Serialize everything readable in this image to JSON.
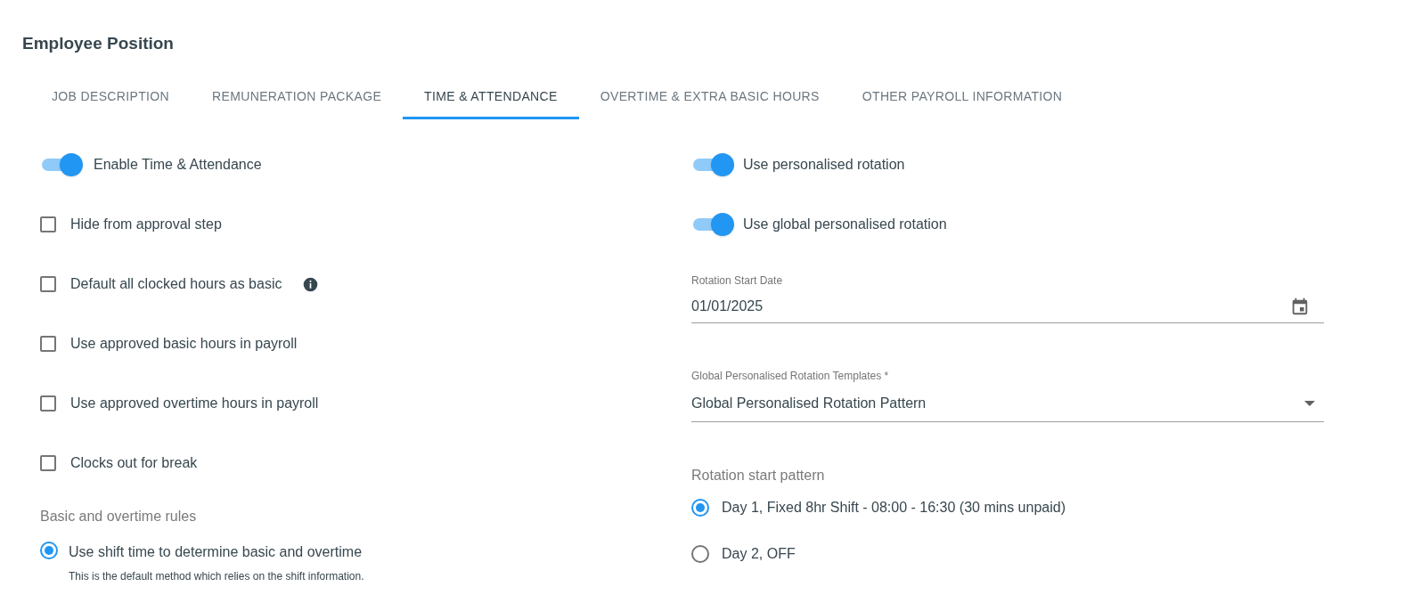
{
  "title": "Employee Position",
  "tabs": [
    {
      "label": "JOB DESCRIPTION",
      "selected": false
    },
    {
      "label": "REMUNERATION PACKAGE",
      "selected": false
    },
    {
      "label": "TIME & ATTENDANCE",
      "selected": true
    },
    {
      "label": "OVERTIME & EXTRA BASIC HOURS",
      "selected": false
    },
    {
      "label": "OTHER PAYROLL INFORMATION",
      "selected": false
    }
  ],
  "left_options": [
    {
      "kind": "toggle",
      "label": "Enable Time & Attendance",
      "on": true
    },
    {
      "kind": "checkbox",
      "label": "Hide from approval step",
      "checked": false
    },
    {
      "kind": "info_checkbox",
      "label": "Default all clocked hours as basic",
      "checked": false
    },
    {
      "kind": "checkbox",
      "label": "Use approved basic hours in payroll",
      "checked": false
    },
    {
      "kind": "checkbox",
      "label": "Use approved overtime hours in payroll",
      "checked": false
    },
    {
      "kind": "checkbox",
      "label": "Clocks out for break",
      "checked": false
    }
  ],
  "rules": {
    "heading": "Basic and overtime rules",
    "options": [
      {
        "label": "Use shift time to determine basic and overtime",
        "description": "This is the default method which relies on the shift information.",
        "selected": true
      }
    ]
  },
  "right_toggles": [
    {
      "label": "Use personalised rotation",
      "on": true
    },
    {
      "label": "Use global personalised rotation",
      "on": true
    }
  ],
  "date_field": {
    "label": "Rotation Start Date",
    "value": "01/01/2025"
  },
  "template_select": {
    "label": "Global Personalised Rotation Templates *",
    "value": "Global Personalised Rotation Pattern"
  },
  "rotation_pattern": {
    "heading": "Rotation start pattern",
    "options": [
      {
        "label": "Day 1, Fixed 8hr Shift - 08:00 - 16:30 (30 mins unpaid)",
        "selected": true
      },
      {
        "label": "Day 2, OFF",
        "selected": false
      }
    ]
  }
}
